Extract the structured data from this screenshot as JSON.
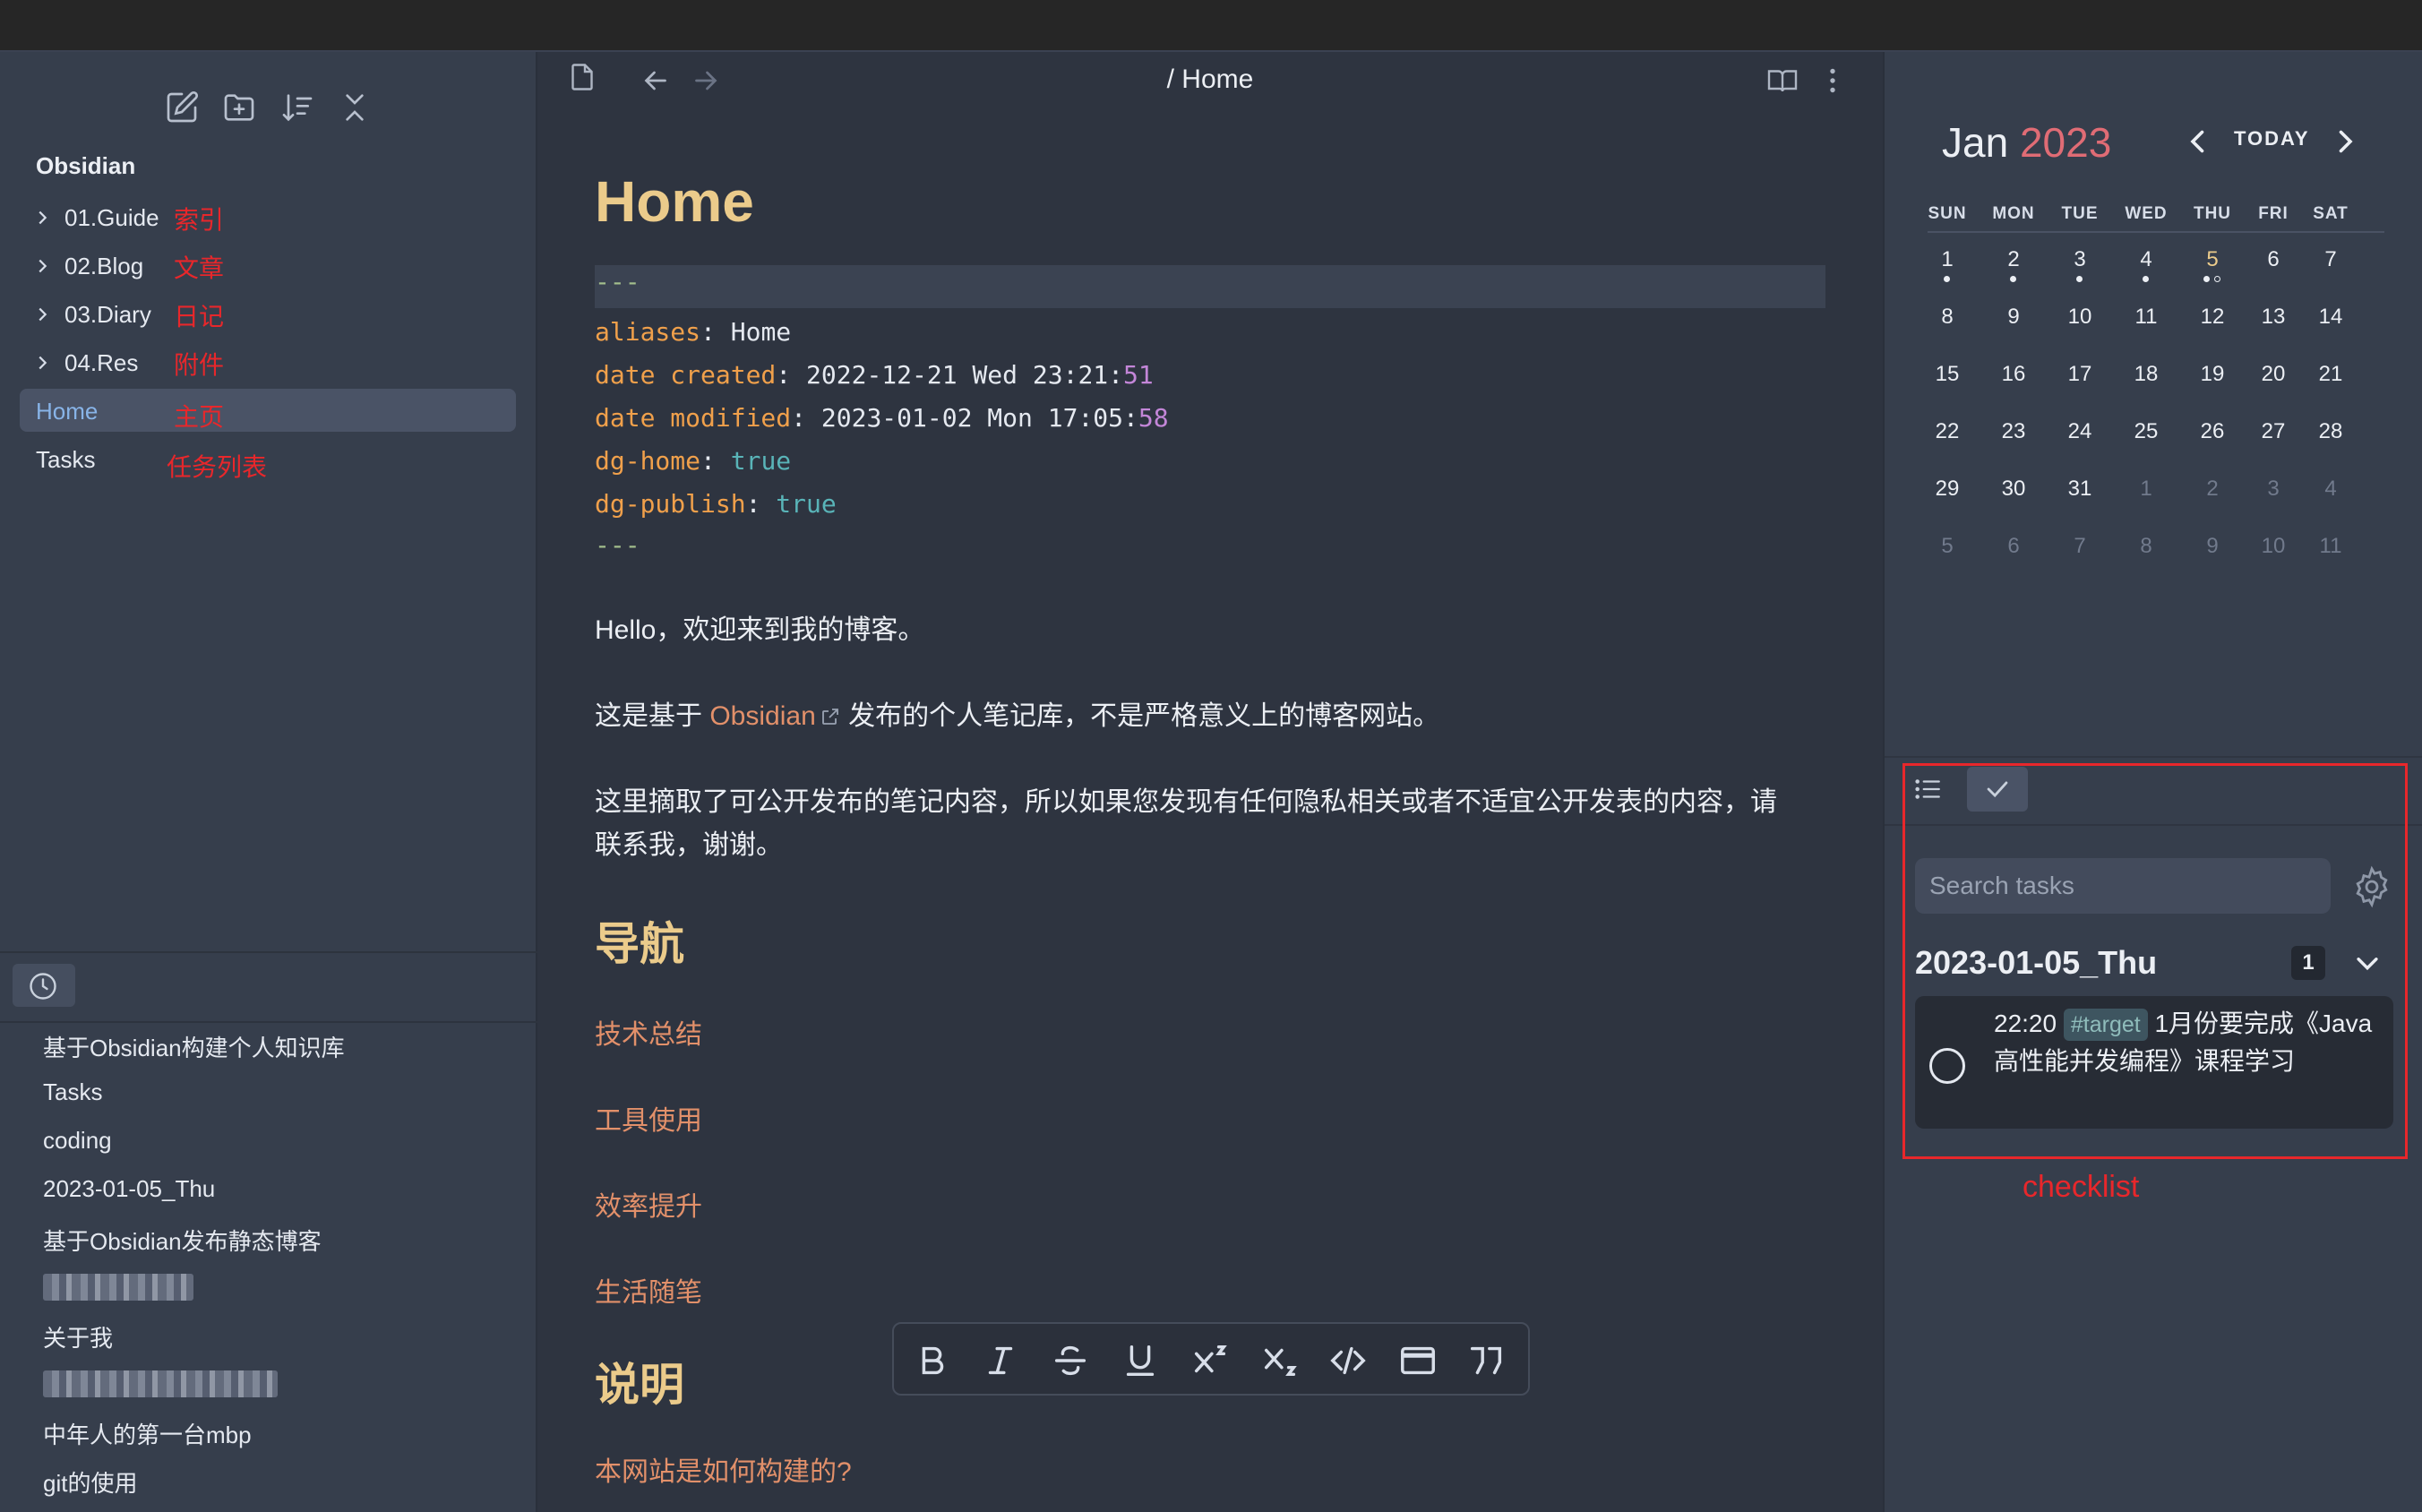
{
  "sidebar": {
    "vault_name": "Obsidian",
    "toolbar_icons": [
      "new-note-icon",
      "new-folder-icon",
      "sort-icon",
      "collapse-all-icon"
    ],
    "tree": [
      {
        "label": "01.Guide",
        "annotation": "索引",
        "folder": true
      },
      {
        "label": "02.Blog",
        "annotation": "文章",
        "folder": true
      },
      {
        "label": "03.Diary",
        "annotation": "日记",
        "folder": true
      },
      {
        "label": "04.Res",
        "annotation": "附件",
        "folder": true
      },
      {
        "label": "Home",
        "annotation": "主页",
        "folder": false,
        "active": true
      },
      {
        "label": "Tasks",
        "annotation": "任务列表",
        "folder": false
      }
    ],
    "recent_files": [
      "基于Obsidian构建个人知识库",
      "Tasks",
      "coding",
      "2023-01-05_Thu",
      "基于Obsidian发布静态博客",
      "",
      "关于我",
      "",
      "中年人的第一台mbp",
      "git的使用"
    ]
  },
  "editor": {
    "breadcrumb": "/ Home",
    "title": "Home",
    "frontmatter": {
      "delimiter": "---",
      "aliases_key": "aliases",
      "aliases_val": "Home",
      "created_key": "date created",
      "created_val": "2022-12-21 Wed 23:21:",
      "created_sec": "51",
      "modified_key": "date modified",
      "modified_val": "2023-01-02 Mon 17:05:",
      "modified_sec": "58",
      "home_key": "dg-home",
      "home_val": "true",
      "publish_key": "dg-publish",
      "publish_val": "true"
    },
    "para1": "Hello，欢迎来到我的博客。",
    "para2_pre": "这是基于 ",
    "para2_link": "Obsidian",
    "para2_post": " 发布的个人笔记库，不是严格意义上的博客网站。",
    "para3": "这里摘取了可公开发布的笔记内容，所以如果您发现有任何隐私相关或者不适宜公开发表的内容，请联系我，谢谢。",
    "h_nav": "导航",
    "nav_links": [
      "技术总结",
      "工具使用",
      "效率提升",
      "生活随笔"
    ],
    "h_about": "说明",
    "about_link": "本网站是如何构建的?"
  },
  "calendar": {
    "month": "Jan",
    "year": "2023",
    "today_label": "TODAY",
    "weekdays": [
      "SUN",
      "MON",
      "TUE",
      "WED",
      "THU",
      "FRI",
      "SAT"
    ],
    "weeks": [
      [
        "1",
        "2",
        "3",
        "4",
        "5",
        "6",
        "7"
      ],
      [
        "8",
        "9",
        "10",
        "11",
        "12",
        "13",
        "14"
      ],
      [
        "15",
        "16",
        "17",
        "18",
        "19",
        "20",
        "21"
      ],
      [
        "22",
        "23",
        "24",
        "25",
        "26",
        "27",
        "28"
      ],
      [
        "29",
        "30",
        "31",
        "1",
        "2",
        "3",
        "4"
      ],
      [
        "5",
        "6",
        "7",
        "8",
        "9",
        "10",
        "11"
      ]
    ]
  },
  "tasks": {
    "search_placeholder": "Search tasks",
    "group_title": "2023-01-05_Thu",
    "group_count": "1",
    "item_time": "22:20",
    "item_tag": "#target",
    "item_text": "1月份要完成《Java高性能并发编程》课程学习",
    "annotation": "checklist"
  }
}
